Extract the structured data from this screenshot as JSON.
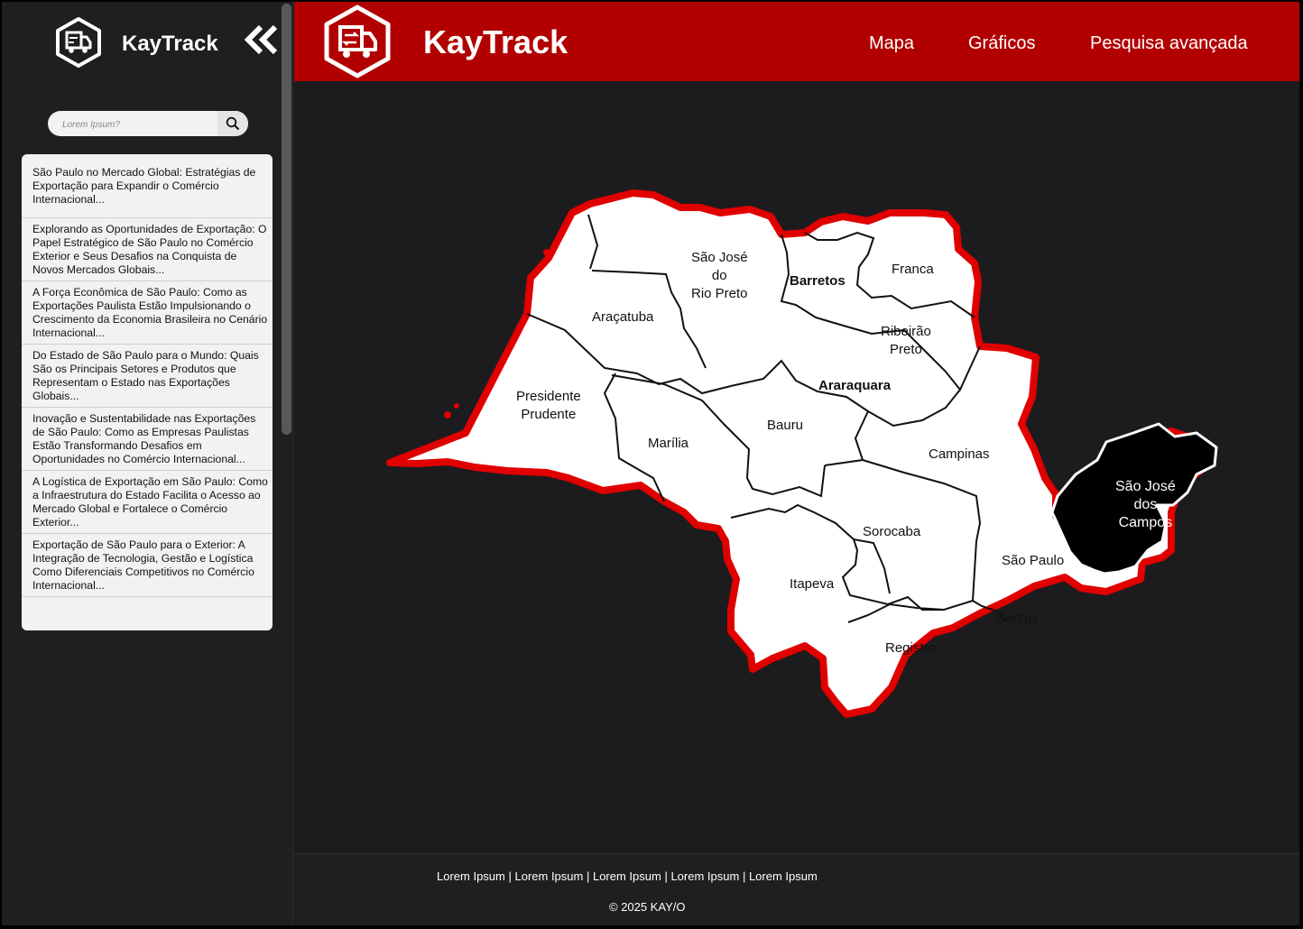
{
  "sidebar": {
    "title": "KayTrack",
    "search_placeholder": "Lorem Ipsum?",
    "news": [
      "São Paulo no Mercado Global: Estratégias de Exportação para Expandir o Comércio Internacional...",
      "Explorando as Oportunidades de Exportação: O Papel Estratégico de São Paulo no Comércio Exterior e Seus Desafios na Conquista de Novos Mercados Globais...",
      "A Força Econômica de São Paulo: Como as Exportações Paulista Estão Impulsionando o Crescimento da Economia Brasileira no Cenário Internacional...",
      "Do Estado de São Paulo para o Mundo: Quais São os Principais Setores e Produtos que Representam o Estado nas Exportações Globais...",
      "Inovação e Sustentabilidade nas Exportações de São Paulo: Como as Empresas Paulistas Estão Transformando Desafios em Oportunidades no Comércio Internacional...",
      "A Logística de Exportação em São Paulo: Como a Infraestrutura do Estado Facilita o Acesso ao Mercado Global e Fortalece o Comércio Exterior...",
      "Exportação de São Paulo para o Exterior: A Integração de Tecnologia, Gestão e Logística Como Diferenciais Competitivos no Comércio Internacional..."
    ]
  },
  "header": {
    "title": "KayTrack",
    "nav": [
      "Mapa",
      "Gráficos",
      "Pesquisa avançada"
    ]
  },
  "map": {
    "highlight_color": "#000000",
    "outline_color": "#e00000",
    "regions": [
      {
        "name": "São José\ndo\nRio Preto"
      },
      {
        "name": "Barretos"
      },
      {
        "name": "Franca"
      },
      {
        "name": "Araçatuba"
      },
      {
        "name": "Ribeirão\nPreto"
      },
      {
        "name": "Araraquara"
      },
      {
        "name": "Presidente\nPrudente"
      },
      {
        "name": "Marília"
      },
      {
        "name": "Bauru"
      },
      {
        "name": "Campinas"
      },
      {
        "name": "São José\ndos\nCampos",
        "selected": true
      },
      {
        "name": "Sorocaba"
      },
      {
        "name": "São Paulo"
      },
      {
        "name": "Itapeva"
      },
      {
        "name": "Santos"
      },
      {
        "name": "Registro"
      }
    ]
  },
  "footer": {
    "links": [
      "Lorem Ipsum",
      "Lorem Ipsum",
      "Lorem Ipsum",
      "Lorem Ipsum",
      "Lorem Ipsum"
    ],
    "copyright": "© 2025 KAY/O"
  }
}
